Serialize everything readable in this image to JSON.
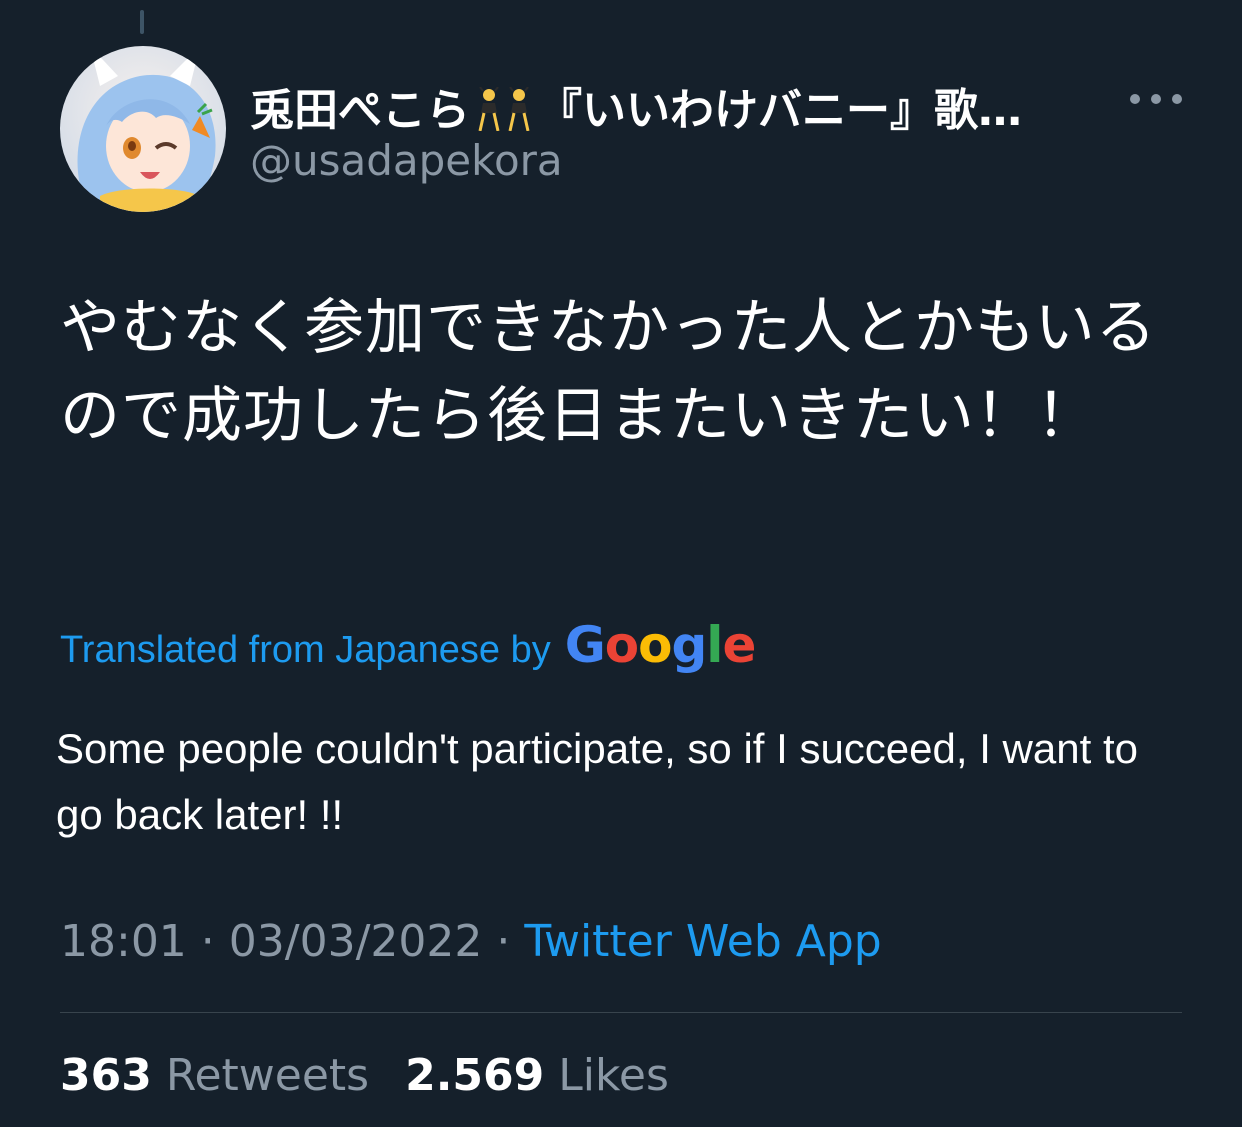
{
  "author": {
    "display_name": "兎田ぺこら",
    "display_name_suffix": "『いいわけバニー』歌…",
    "name_emoji": "dancing-women-emoji",
    "handle": "@usadapekora",
    "avatar": "avatar-image"
  },
  "tweet": {
    "text_original": "やむなく参加できなかった人とかもいるので成功したら後日またいきたい！！",
    "translated_label": "Translated from Japanese by",
    "translator_logo": "Google",
    "text_translated": "Some people couldn't participate, so if I succeed, I want to go back later! !!"
  },
  "meta": {
    "time": "18:01",
    "separator": " · ",
    "date": "03/03/2022",
    "source": "Twitter Web App"
  },
  "stats": {
    "retweets_count": "363",
    "retweets_label": "Retweets",
    "likes_count": "2.569",
    "likes_label": "Likes"
  },
  "icons": {
    "more": "more-options-icon"
  },
  "colors": {
    "background": "#15202b",
    "accent": "#1d9bf0",
    "muted_text": "#8b98a5",
    "divider": "#38444d"
  }
}
